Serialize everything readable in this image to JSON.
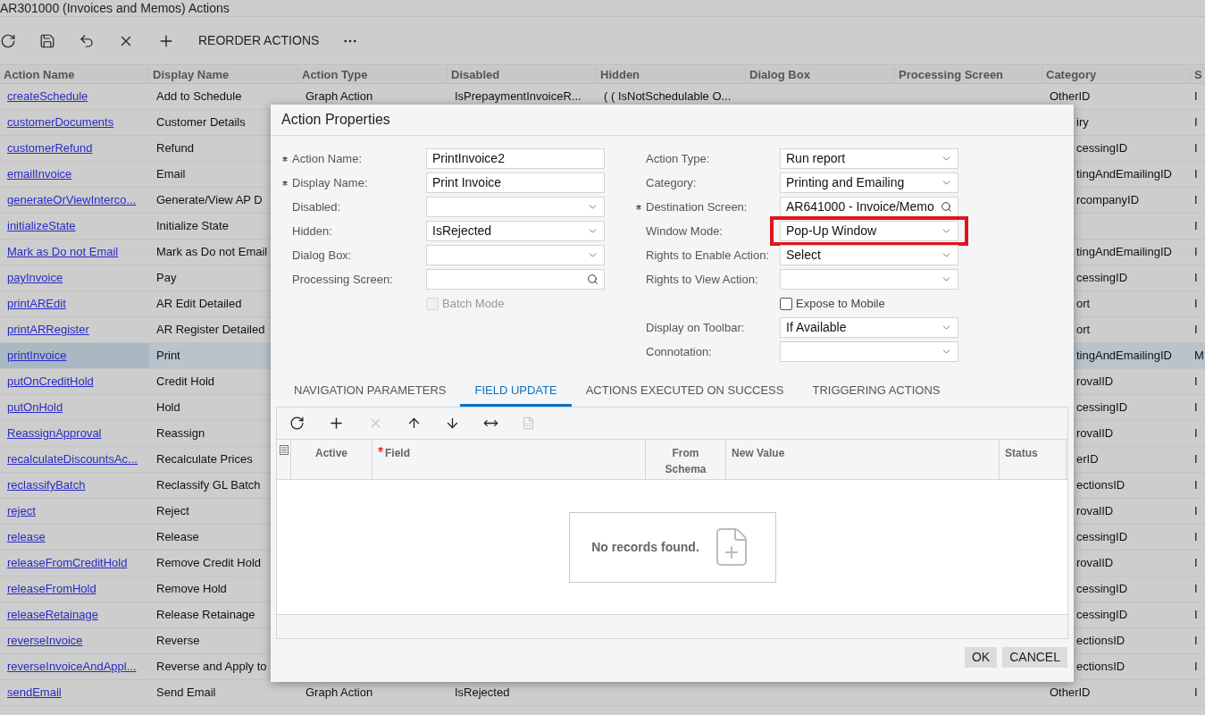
{
  "window": {
    "title": "AR301000 (Invoices and Memos) Actions"
  },
  "toolbar": [
    {
      "kind": "refresh"
    },
    {
      "kind": "save"
    },
    {
      "kind": "undo"
    },
    {
      "kind": "delete"
    },
    {
      "kind": "add"
    },
    {
      "kind": "text",
      "label": "REORDER ACTIONS"
    },
    {
      "kind": "more"
    }
  ],
  "table": {
    "columns": [
      "Action Name",
      "Display Name",
      "Action Type",
      "Disabled",
      "Hidden",
      "Dialog Box",
      "Processing Screen",
      "Category",
      "S"
    ],
    "rows": [
      {
        "action_name": "createSchedule",
        "display_name": "Add to Schedule",
        "action_type": "Graph Action",
        "disabled": "IsPrepaymentInvoiceR...",
        "hidden": "( ( IsNotSchedulable O...",
        "category": "OtherID",
        "column_9": "I",
        "selected": false
      },
      {
        "action_name": "customerDocuments",
        "display_name": "Customer Details",
        "category": "iry",
        "column_9": "I",
        "selected": false
      },
      {
        "action_name": "customerRefund",
        "display_name": "Refund",
        "category": "cessingID",
        "column_9": "I",
        "selected": false
      },
      {
        "action_name": "emailInvoice",
        "display_name": "Email",
        "category": "tingAndEmailingID",
        "column_9": "I",
        "selected": false
      },
      {
        "action_name": "generateOrViewInterco...",
        "display_name": "Generate/View AP D",
        "category": "rcompanyID",
        "column_9": "I",
        "selected": false
      },
      {
        "action_name": "initializeState",
        "display_name": "Initialize State",
        "column_9": "I",
        "selected": false
      },
      {
        "action_name": "Mark as Do not Email",
        "display_name": "Mark as Do not Email",
        "category": "tingAndEmailingID",
        "column_9": "I",
        "selected": false
      },
      {
        "action_name": "payInvoice",
        "display_name": "Pay",
        "category": "cessingID",
        "column_9": "I",
        "selected": false
      },
      {
        "action_name": "printAREdit",
        "display_name": "AR Edit Detailed",
        "category": "ort",
        "column_9": "I",
        "selected": false
      },
      {
        "action_name": "printARRegister",
        "display_name": "AR Register Detailed",
        "category": "ort",
        "column_9": "I",
        "selected": false
      },
      {
        "action_name": "printInvoice",
        "display_name": "Print",
        "category": "tingAndEmailingID",
        "column_9": "M",
        "selected": true
      },
      {
        "action_name": "putOnCreditHold",
        "display_name": "Credit Hold",
        "category": "rovalID",
        "column_9": "I",
        "selected": false
      },
      {
        "action_name": "putOnHold",
        "display_name": "Hold",
        "category": "cessingID",
        "column_9": "I",
        "selected": false
      },
      {
        "action_name": "ReassignApproval",
        "display_name": "Reassign",
        "category": "rovalID",
        "column_9": "I",
        "selected": false
      },
      {
        "action_name": "recalculateDiscountsAc...",
        "display_name": "Recalculate Prices",
        "category": "erID",
        "column_9": "I",
        "selected": false
      },
      {
        "action_name": "reclassifyBatch",
        "display_name": "Reclassify GL Batch",
        "category": "ectionsID",
        "column_9": "I",
        "selected": false
      },
      {
        "action_name": "reject",
        "display_name": "Reject",
        "category": "rovalID",
        "column_9": "I",
        "selected": false
      },
      {
        "action_name": "release",
        "display_name": "Release",
        "category": "cessingID",
        "column_9": "I",
        "selected": false
      },
      {
        "action_name": "releaseFromCreditHold",
        "display_name": "Remove Credit Hold",
        "category": "rovalID",
        "column_9": "I",
        "selected": false
      },
      {
        "action_name": "releaseFromHold",
        "display_name": "Remove Hold",
        "category": "cessingID",
        "column_9": "I",
        "selected": false
      },
      {
        "action_name": "releaseRetainage",
        "display_name": "Release Retainage",
        "category": "cessingID",
        "column_9": "I",
        "selected": false
      },
      {
        "action_name": "reverseInvoice",
        "display_name": "Reverse",
        "category": "ectionsID",
        "column_9": "I",
        "selected": false
      },
      {
        "action_name": "reverseInvoiceAndAppl...",
        "display_name": "Reverse and Apply to",
        "category": "ectionsID",
        "column_9": "I",
        "selected": false
      },
      {
        "action_name": "sendEmail",
        "display_name": "Send Email",
        "action_type": "Graph Action",
        "disabled": "IsRejected",
        "category": "OtherID",
        "column_9": "I",
        "selected": false
      }
    ]
  },
  "dialog": {
    "title": "Action Properties",
    "left_fields": [
      {
        "kind": "text",
        "label": "Action Name:",
        "required": true,
        "value": "PrintInvoice2"
      },
      {
        "kind": "text",
        "label": "Display Name:",
        "required": true,
        "value": "Print Invoice"
      },
      {
        "kind": "select",
        "label": "Disabled:",
        "required": false
      },
      {
        "kind": "select",
        "label": "Hidden:",
        "required": false,
        "value": "IsRejected"
      },
      {
        "kind": "select",
        "label": "Dialog Box:",
        "required": false
      },
      {
        "kind": "lookup",
        "label": "Processing Screen:",
        "required": false
      },
      {
        "kind": "checkbox",
        "label": "Batch Mode",
        "checked": false,
        "disabled": true
      }
    ],
    "right_fields": [
      {
        "kind": "select",
        "label": "Action Type:",
        "required": false,
        "value": "Run report"
      },
      {
        "kind": "select",
        "label": "Category:",
        "required": false,
        "value": "Printing and Emailing"
      },
      {
        "kind": "lookup",
        "label": "Destination Screen:",
        "required": true,
        "value": "AR641000 - Invoice/Memo"
      },
      {
        "kind": "select",
        "label": "Window Mode:",
        "required": false,
        "value": "Pop-Up Window",
        "highlighted": true
      },
      {
        "kind": "select",
        "label": "Rights to Enable Action:",
        "required": false,
        "value": "Select"
      },
      {
        "kind": "select",
        "label": "Rights to View Action:",
        "required": false
      },
      {
        "kind": "checkbox",
        "label": "Expose to Mobile",
        "checked": false,
        "disabled": false
      },
      {
        "kind": "select",
        "label": "Display on Toolbar:",
        "required": false,
        "value": "If Available"
      },
      {
        "kind": "select",
        "label": "Connotation:",
        "required": false
      }
    ],
    "tabs": [
      {
        "label": "NAVIGATION PARAMETERS",
        "selected": false
      },
      {
        "label": "FIELD UPDATE",
        "selected": true
      },
      {
        "label": "ACTIONS EXECUTED ON SUCCESS",
        "selected": false
      },
      {
        "label": "TRIGGERING ACTIONS",
        "selected": false
      }
    ],
    "grid_toolbar": [
      {
        "kind": "refresh",
        "disabled": false
      },
      {
        "kind": "add",
        "disabled": false
      },
      {
        "kind": "delete",
        "disabled": true
      },
      {
        "kind": "up",
        "disabled": false
      },
      {
        "kind": "down",
        "disabled": false
      },
      {
        "kind": "fit",
        "disabled": false
      },
      {
        "kind": "excel",
        "disabled": true
      }
    ],
    "grid_columns": [
      {
        "label": "Active",
        "required": false
      },
      {
        "label": "Field",
        "required": true
      },
      {
        "label": "From Schema",
        "required": false
      },
      {
        "label": "New Value",
        "required": false
      },
      {
        "label": "Status",
        "required": false
      }
    ],
    "empty_message": "No records found.",
    "buttons": [
      "OK",
      "CANCEL"
    ]
  }
}
